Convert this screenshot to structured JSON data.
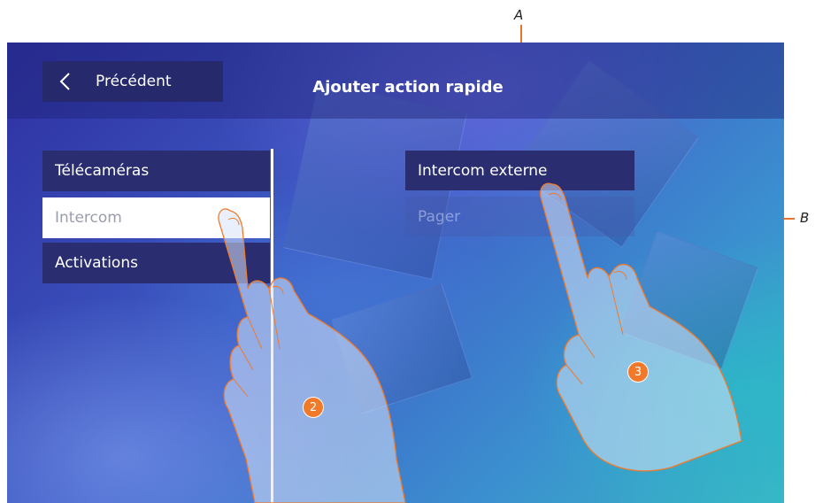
{
  "callouts": {
    "a": "A",
    "b": "B"
  },
  "header": {
    "back_label": "Précédent",
    "title": "Ajouter action rapide"
  },
  "left_menu": {
    "items": [
      {
        "label": "Télécaméras"
      },
      {
        "label": "Intercom"
      },
      {
        "label": "Activations"
      }
    ]
  },
  "right_menu": {
    "items": [
      {
        "label": "Intercom externe"
      },
      {
        "label": "Pager"
      }
    ]
  },
  "steps": {
    "left": "2",
    "right": "3"
  },
  "colors": {
    "accent": "#f07a2a",
    "item_bg": "#2a2d70",
    "selected_bg": "#ffffff"
  },
  "icons": {
    "back": "chevron-left-icon",
    "hand": "pointing-hand-icon"
  }
}
